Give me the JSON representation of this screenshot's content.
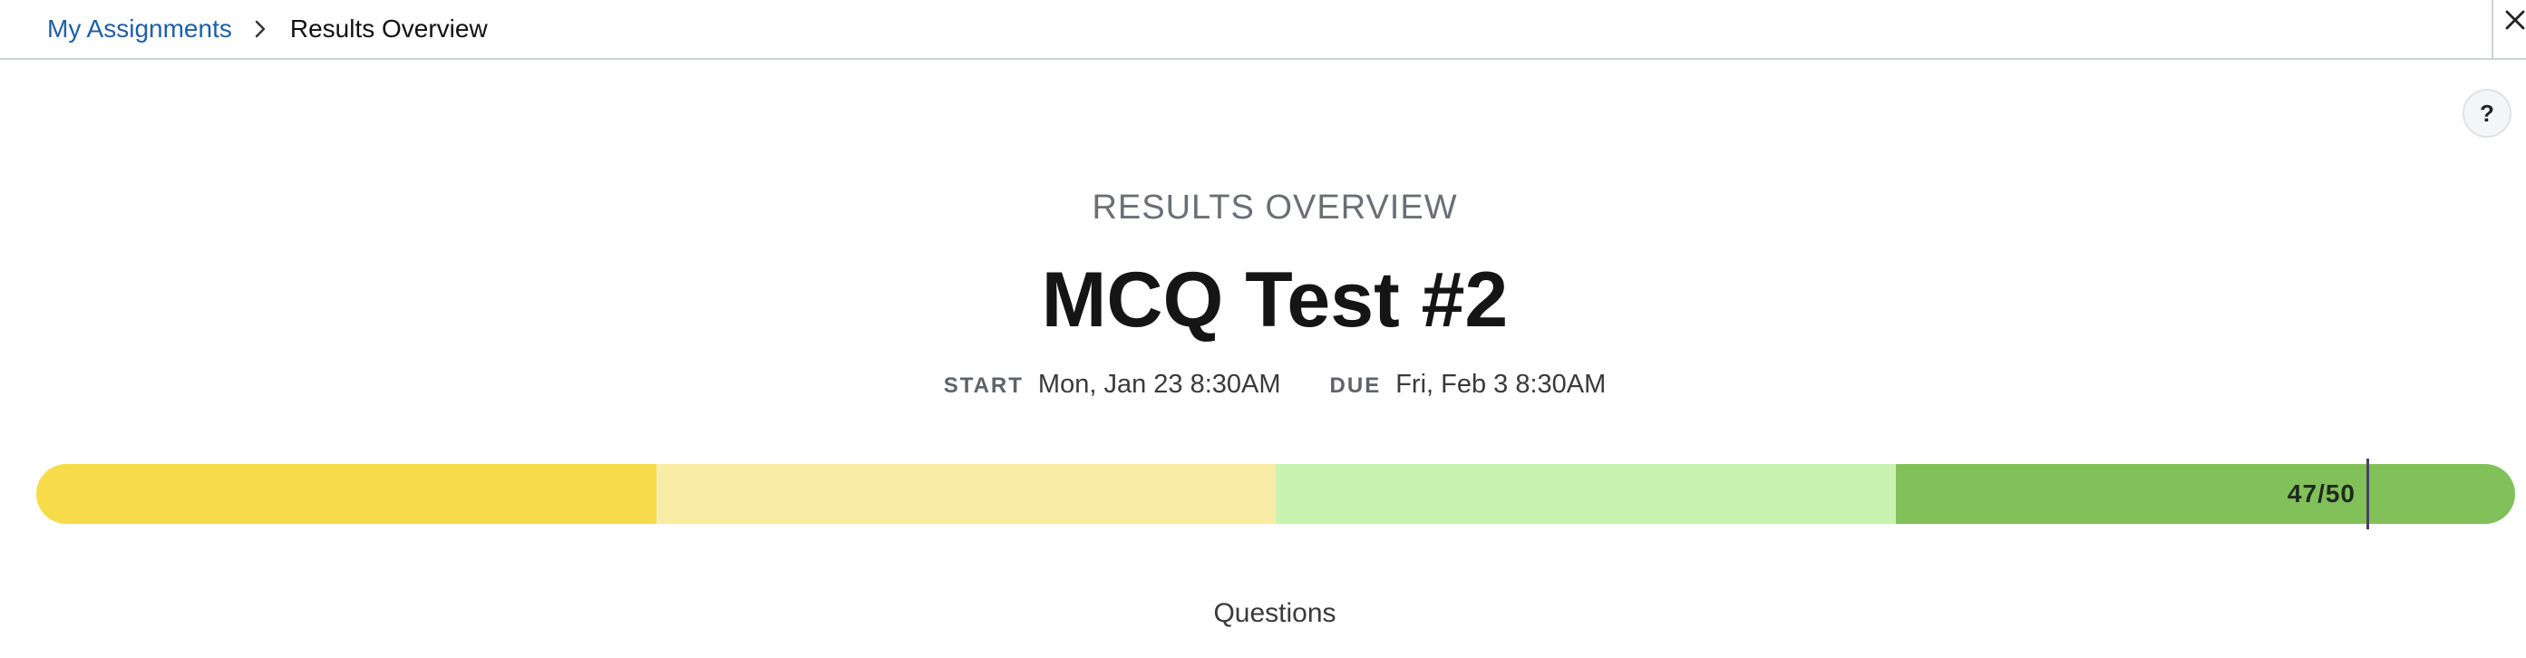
{
  "breadcrumb": {
    "parent_label": "My Assignments",
    "current_label": "Results Overview"
  },
  "help": {
    "label": "?"
  },
  "header": {
    "overview_label": "RESULTS OVERVIEW",
    "title": "MCQ Test #2"
  },
  "dates": {
    "start_key": "START",
    "start_value": "Mon, Jan 23 8:30AM",
    "due_key": "DUE",
    "due_value": "Fri, Feb 3 8:30AM"
  },
  "score": {
    "label": "47/50",
    "earned": 47,
    "total": 50,
    "bands": [
      {
        "color": "#f8db4a"
      },
      {
        "color": "#f9eca6"
      },
      {
        "color": "#c9f3b0"
      },
      {
        "color": "#82c05a"
      }
    ]
  },
  "questions": {
    "heading": "Questions"
  },
  "icons": {
    "breadcrumb_separator": "chevron-right-icon",
    "close": "close-icon",
    "help": "question-mark-icon"
  }
}
